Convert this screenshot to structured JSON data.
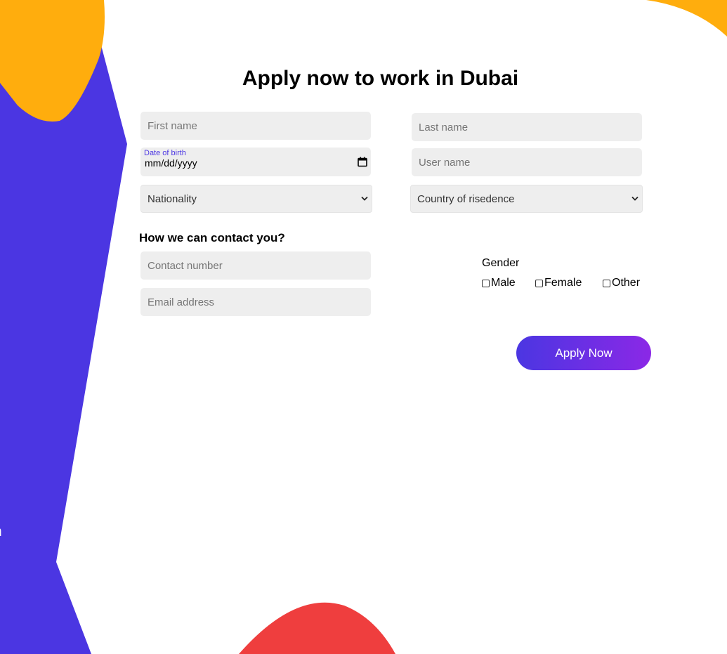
{
  "page": {
    "title": "Apply now to work in Dubai",
    "side_text": "m"
  },
  "form": {
    "first_name_placeholder": "First name",
    "last_name_placeholder": "Last name",
    "dob_label": "Date of birth",
    "dob_value": "mm/dd/yyyy",
    "username_placeholder": "User name",
    "nationality_selected": "Nationality",
    "country_selected": "Country of risedence",
    "contact_heading": "How we can contact you?",
    "contact_number_placeholder": "Contact number",
    "email_placeholder": "Email address",
    "gender_label": "Gender",
    "gender_options": [
      "Male",
      "Female",
      "Other"
    ],
    "submit_label": "Apply Now"
  },
  "colors": {
    "purple": "#4b36e2",
    "orange": "#ffad0d",
    "red": "#ef3e3e",
    "field_bg": "#eeeeee",
    "button_gradient_end": "#8b28e6"
  },
  "icons": {
    "date_picker": "calendar-icon",
    "select": "chevron-down-icon"
  }
}
